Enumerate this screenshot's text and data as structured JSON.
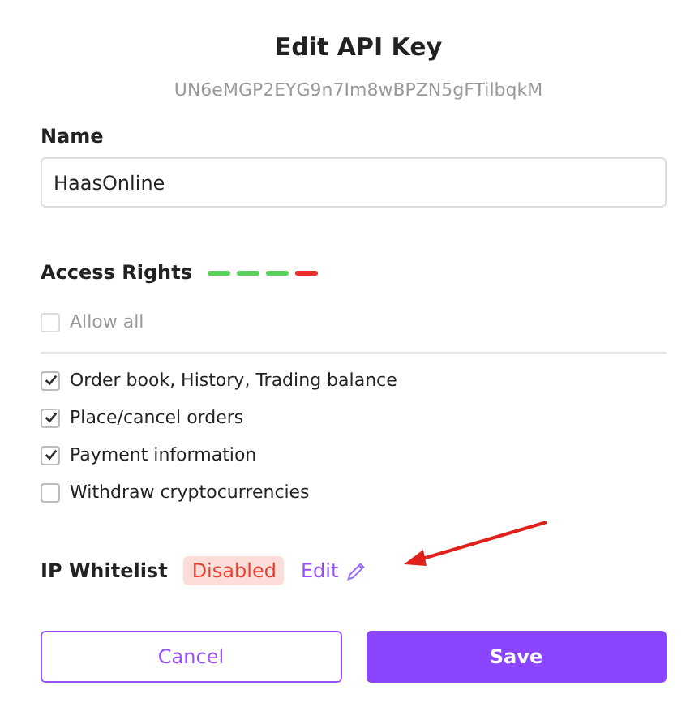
{
  "dialog": {
    "title": "Edit API Key",
    "api_key": "UN6eMGP2EYG9n7Im8wBPZN5gFTilbqkM"
  },
  "name_field": {
    "label": "Name",
    "value": "HaasOnline"
  },
  "access_rights": {
    "label": "Access Rights",
    "strength": [
      {
        "color": "#5ad15a"
      },
      {
        "color": "#5ad15a"
      },
      {
        "color": "#5ad15a"
      },
      {
        "color": "#e8302a"
      }
    ],
    "allow_all": {
      "label": "Allow all",
      "checked": false,
      "disabled": true
    },
    "permissions": [
      {
        "label": "Order book, History, Trading balance",
        "checked": true
      },
      {
        "label": "Place/cancel orders",
        "checked": true
      },
      {
        "label": "Payment information",
        "checked": true
      },
      {
        "label": "Withdraw cryptocurrencies",
        "checked": false
      }
    ]
  },
  "ip_whitelist": {
    "label": "IP Whitelist",
    "status": "Disabled",
    "edit": "Edit"
  },
  "buttons": [
    {
      "label": "Cancel",
      "kind": "secondary"
    },
    {
      "label": "Save",
      "kind": "primary"
    }
  ]
}
